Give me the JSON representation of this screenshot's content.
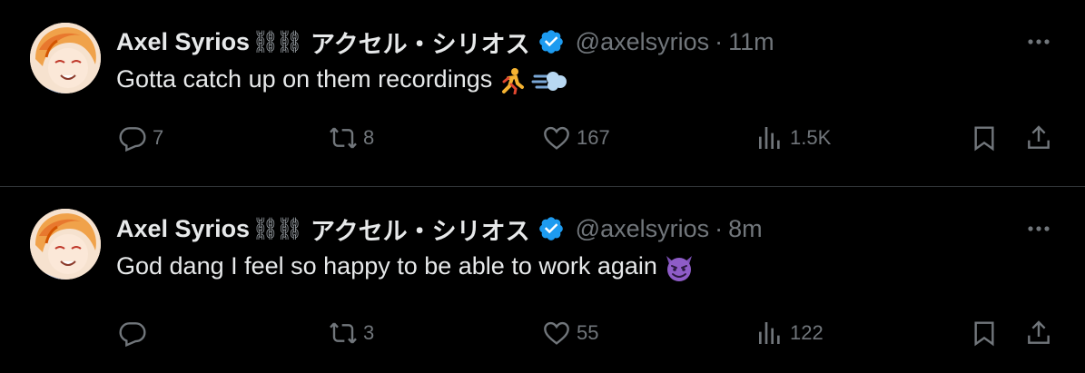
{
  "tweets": [
    {
      "author_name": "Axel Syrios",
      "author_chain": "⛓⛓",
      "author_jp": "アクセル・シリオス",
      "handle": "@axelsyrios",
      "separator": "·",
      "time": "11m",
      "text": "Gotta catch up on them recordings",
      "emoji": [
        "runner-emoji",
        "dash-emoji"
      ],
      "replies": "7",
      "reposts": "8",
      "likes": "167",
      "views": "1.5K"
    },
    {
      "author_name": "Axel Syrios",
      "author_chain": "⛓⛓",
      "author_jp": "アクセル・シリオス",
      "handle": "@axelsyrios",
      "separator": "·",
      "time": "8m",
      "text": "God dang I feel so happy to be able to work again",
      "emoji": [
        "smiling-imp-emoji"
      ],
      "replies": "",
      "reposts": "3",
      "likes": "55",
      "views": "122"
    }
  ],
  "colors": {
    "background": "#000000",
    "text": "#e7e9ea",
    "muted": "#71767b",
    "verified": "#1d9bf0",
    "divider": "#2f3336"
  },
  "icons": [
    "reply-icon",
    "repost-icon",
    "like-icon",
    "views-icon",
    "bookmark-icon",
    "share-icon",
    "more-icon",
    "verified-badge-icon"
  ]
}
